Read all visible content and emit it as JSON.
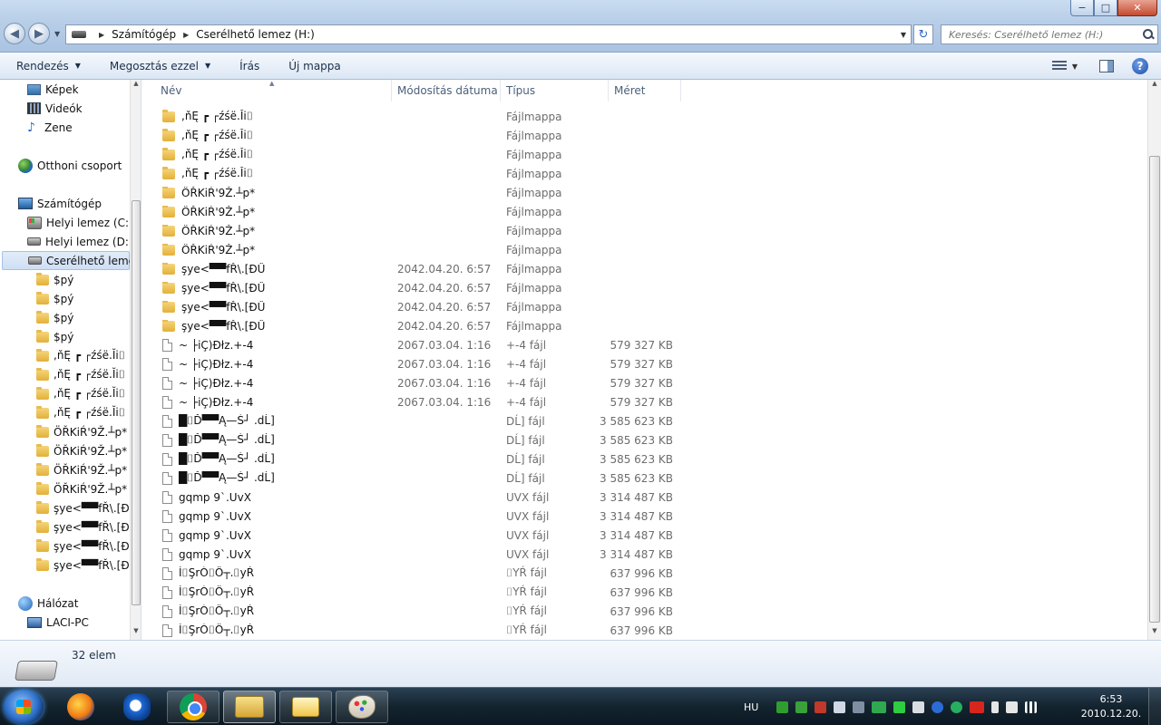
{
  "window": {
    "min_glyph": "−",
    "max_glyph": "□",
    "close_glyph": "✕"
  },
  "address": {
    "crumbs": [
      "Számítógép",
      "Cserélhető lemez (H:)"
    ]
  },
  "search": {
    "placeholder": "Keresés: Cserélhető lemez (H:)"
  },
  "toolbar": {
    "organize": "Rendezés",
    "share": "Megosztás ezzel",
    "burn": "Írás",
    "new_folder": "Új mappa"
  },
  "nav": {
    "pictures": "Képek",
    "videos": "Videók",
    "music": "Zene",
    "homegroup": "Otthoni csoport",
    "computer": "Számítógép",
    "drive_c": "Helyi lemez (C:)",
    "drive_d": "Helyi lemez (D:)",
    "drive_h": "Cserélhető lemez (H:)",
    "subfolders": [
      "$pý",
      "$pý",
      "$pý",
      "$pý",
      ",ňĘ ┏ ┌źśë.Ĭi⌷",
      ",ňĘ ┏ ┌źśë.Ĭi⌷",
      ",ňĘ ┏ ┌źśë.Ĭi⌷",
      ",ňĘ ┏ ┌źśë.Ĭi⌷",
      "ÖŘKiŔ'9Ž.┴p*",
      "ÖŘKiŔ'9Ž.┴p*",
      "ÖŘKiŔ'9Ž.┴p*",
      "ÖŘKiŔ'9Ž.┴p*",
      "şye<▀▀fŘ\\.[ĐŰ",
      "şye<▀▀fŘ\\.[ĐŰ",
      "şye<▀▀fŘ\\.[ĐŰ",
      "şye<▀▀fŘ\\.[ĐŰ"
    ],
    "network": "Hálózat",
    "network_pc": "LACI-PC"
  },
  "columns": {
    "name": "Név",
    "date": "Módosítás dátuma",
    "type": "Típus",
    "size": "Méret"
  },
  "files": [
    {
      "name": ",ňĘ ┏ ┌źśë.Ĭi⌷",
      "date": "",
      "type": "Fájlmappa",
      "size": "",
      "kind": "folder"
    },
    {
      "name": ",ňĘ ┏ ┌źśë.Ĭi⌷",
      "date": "",
      "type": "Fájlmappa",
      "size": "",
      "kind": "folder"
    },
    {
      "name": ",ňĘ ┏ ┌źśë.Ĭi⌷",
      "date": "",
      "type": "Fájlmappa",
      "size": "",
      "kind": "folder"
    },
    {
      "name": ",ňĘ ┏ ┌źśë.Ĭi⌷",
      "date": "",
      "type": "Fájlmappa",
      "size": "",
      "kind": "folder"
    },
    {
      "name": "ÖŘKiŔ'9Ž.┴p*",
      "date": "",
      "type": "Fájlmappa",
      "size": "",
      "kind": "folder"
    },
    {
      "name": "ÖŘKiŔ'9Ž.┴p*",
      "date": "",
      "type": "Fájlmappa",
      "size": "",
      "kind": "folder"
    },
    {
      "name": "ÖŘKiŔ'9Ž.┴p*",
      "date": "",
      "type": "Fájlmappa",
      "size": "",
      "kind": "folder"
    },
    {
      "name": "ÖŘKiŔ'9Ž.┴p*",
      "date": "",
      "type": "Fájlmappa",
      "size": "",
      "kind": "folder"
    },
    {
      "name": "şye<▀▀fŘ\\.[ĐŰ",
      "date": "2042.04.20. 6:57",
      "type": "Fájlmappa",
      "size": "",
      "kind": "folder"
    },
    {
      "name": "şye<▀▀fŘ\\.[ĐŰ",
      "date": "2042.04.20. 6:57",
      "type": "Fájlmappa",
      "size": "",
      "kind": "folder"
    },
    {
      "name": "şye<▀▀fŘ\\.[ĐŰ",
      "date": "2042.04.20. 6:57",
      "type": "Fájlmappa",
      "size": "",
      "kind": "folder"
    },
    {
      "name": "şye<▀▀fŘ\\.[ĐŰ",
      "date": "2042.04.20. 6:57",
      "type": "Fájlmappa",
      "size": "",
      "kind": "folder"
    },
    {
      "name": "~ ├iÇ)Đłz.+-4",
      "date": "2067.03.04. 1:16",
      "type": "+-4 fájl",
      "size": "579 327 KB",
      "kind": "file"
    },
    {
      "name": "~ ├iÇ)Đłz.+-4",
      "date": "2067.03.04. 1:16",
      "type": "+-4 fájl",
      "size": "579 327 KB",
      "kind": "file"
    },
    {
      "name": "~ ├iÇ)Đłz.+-4",
      "date": "2067.03.04. 1:16",
      "type": "+-4 fájl",
      "size": "579 327 KB",
      "kind": "file"
    },
    {
      "name": "~ ├iÇ)Đłz.+-4",
      "date": "2067.03.04. 1:16",
      "type": "+-4 fájl",
      "size": "579 327 KB",
      "kind": "file"
    },
    {
      "name": "█⌷Ď▀▀Ą—Ś┘ .dĹ]",
      "date": "",
      "type": "DĹ] fájl",
      "size": "3 585 623 KB",
      "kind": "file"
    },
    {
      "name": "█⌷Ď▀▀Ą—Ś┘ .dĹ]",
      "date": "",
      "type": "DĹ] fájl",
      "size": "3 585 623 KB",
      "kind": "file"
    },
    {
      "name": "█⌷Ď▀▀Ą—Ś┘ .dĹ]",
      "date": "",
      "type": "DĹ] fájl",
      "size": "3 585 623 KB",
      "kind": "file"
    },
    {
      "name": "█⌷Ď▀▀Ą—Ś┘ .dĹ]",
      "date": "",
      "type": "DĹ] fájl",
      "size": "3 585 623 KB",
      "kind": "file"
    },
    {
      "name": "gqmp 9`.UvX",
      "date": "",
      "type": "UVX fájl",
      "size": "3 314 487 KB",
      "kind": "file"
    },
    {
      "name": "gqmp 9`.UvX",
      "date": "",
      "type": "UVX fájl",
      "size": "3 314 487 KB",
      "kind": "file"
    },
    {
      "name": "gqmp 9`.UvX",
      "date": "",
      "type": "UVX fájl",
      "size": "3 314 487 KB",
      "kind": "file"
    },
    {
      "name": "gqmp 9`.UvX",
      "date": "",
      "type": "UVX fájl",
      "size": "3 314 487 KB",
      "kind": "file"
    },
    {
      "name": "Í⌷ŞrÓ⌷Ö┬.⌷yŔ",
      "date": "",
      "type": "⌷YŔ fájl",
      "size": "637 996 KB",
      "kind": "file"
    },
    {
      "name": "Í⌷ŞrÓ⌷Ö┬.⌷yŔ",
      "date": "",
      "type": "⌷YŔ fájl",
      "size": "637 996 KB",
      "kind": "file"
    },
    {
      "name": "Í⌷ŞrÓ⌷Ö┬.⌷yŔ",
      "date": "",
      "type": "⌷YŔ fájl",
      "size": "637 996 KB",
      "kind": "file"
    },
    {
      "name": "Í⌷ŞrÓ⌷Ö┬.⌷yŔ",
      "date": "",
      "type": "⌷YŔ fájl",
      "size": "637 996 KB",
      "kind": "file"
    }
  ],
  "status": {
    "count": "32 elem"
  },
  "taskbar": {
    "lang": "HU",
    "time": "6:53",
    "date": "2010.12.20."
  }
}
